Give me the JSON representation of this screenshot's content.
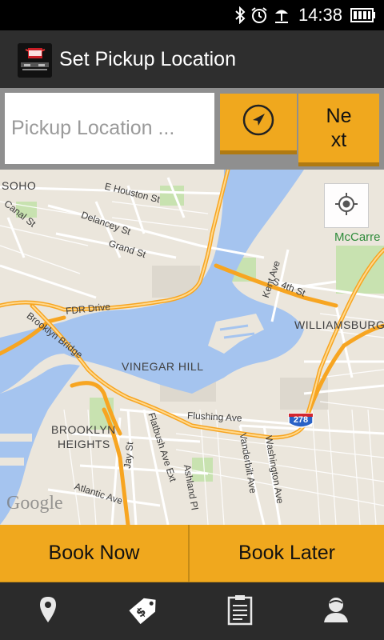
{
  "status_bar": {
    "time": "14:38",
    "icons": [
      "bluetooth-icon",
      "alarm-icon",
      "beach-icon",
      "battery-icon"
    ]
  },
  "app_bar": {
    "title": "Set Pickup Location",
    "logo_icon": "app-logo-icon"
  },
  "search": {
    "placeholder": "Pickup Location ...",
    "value": "",
    "locate_icon": "navigation-arrow-icon",
    "next_label": "Next"
  },
  "map": {
    "labels": {
      "soho": "SOHO",
      "e_houston": "E Houston St",
      "canal": "Canal St",
      "delancey": "Delancey St",
      "grand": "Grand St",
      "fdr": "FDR Drive",
      "brooklyn_bridge": "Brooklyn Bridge",
      "vinegar_hill": "VINEGAR HILL",
      "williamsburg": "WILLIAMSBURG",
      "mccarren": "McCarre",
      "kent": "Kent Ave",
      "s4th": "S 4th St",
      "flushing": "Flushing Ave",
      "brooklyn_heights_1": "BROOKLYN",
      "brooklyn_heights_2": "HEIGHTS",
      "jay": "Jay St",
      "flatbush": "Flatbush Ave Ext",
      "ashland": "Ashland Pl",
      "vanderbilt": "Vanderbilt Ave",
      "washington": "Washington Ave",
      "atlantic": "Atlantic Ave",
      "route": "278",
      "google": "Google"
    },
    "colors": {
      "land": "#ebe6dc",
      "water": "#a5c4ef",
      "highway": "#f7a521",
      "road": "#ffffff",
      "park": "#c8e2b0"
    }
  },
  "actions": {
    "book_now": "Book Now",
    "book_later": "Book Later"
  },
  "bottom_nav": {
    "items": [
      {
        "icon": "location-pin-icon"
      },
      {
        "icon": "price-tag-icon"
      },
      {
        "icon": "clipboard-icon"
      },
      {
        "icon": "profile-icon"
      }
    ]
  },
  "colors": {
    "accent": "#f0a81e",
    "accent_dark": "#b07a12",
    "app_bar": "#2e2e2e"
  }
}
